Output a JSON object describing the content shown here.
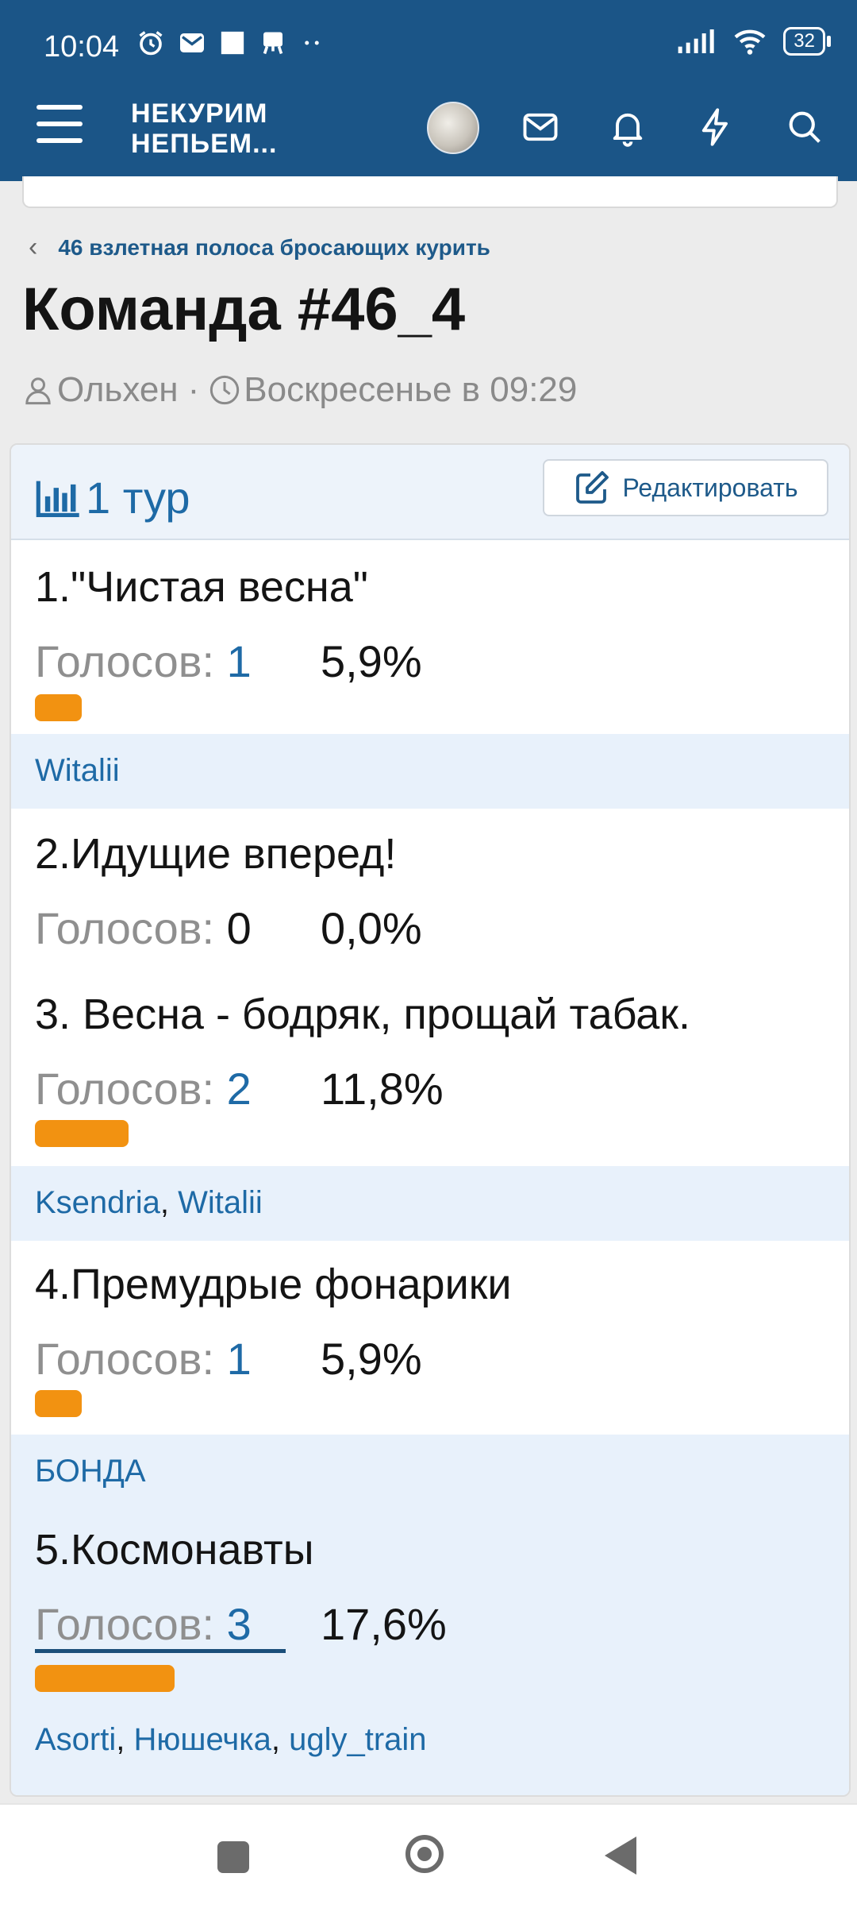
{
  "status": {
    "time": "10:04",
    "battery": "32"
  },
  "header": {
    "logo_line1": "НЕКУРИМ",
    "logo_line2": "НЕПЬЕМ..."
  },
  "breadcrumb": {
    "parent": "46 взлетная полоса бросающих курить"
  },
  "thread": {
    "title": "Команда #46_4",
    "author": "Ольхен",
    "separator": "·",
    "date": "Воскресенье в 09:29"
  },
  "poll": {
    "title": "1 тур",
    "edit_label": "Редактировать",
    "votes_label": "Голосов:",
    "options": [
      {
        "label": "1.\"Чистая весна\"",
        "votes": "1",
        "percent": "5,9%",
        "fill": 0.059,
        "voters": [
          "Witalii"
        ]
      },
      {
        "label": "2.Идущие вперед!",
        "votes": "0",
        "percent": "0,0%",
        "fill": 0.0,
        "voters": []
      },
      {
        "label": "3. Весна - бодряк, прощай табак.",
        "votes": "2",
        "percent": "11,8%",
        "fill": 0.118,
        "voters": [
          "Ksendria",
          "Witalii"
        ]
      },
      {
        "label": "4.Премудрые фонарики",
        "votes": "1",
        "percent": "5,9%",
        "fill": 0.059,
        "voters": [
          "БОНДА"
        ]
      },
      {
        "label": "5.Космонавты",
        "votes": "3",
        "percent": "17,6%",
        "fill": 0.176,
        "voters": [
          "Asorti",
          "Нюшечка",
          "ugly_train"
        ]
      }
    ]
  }
}
